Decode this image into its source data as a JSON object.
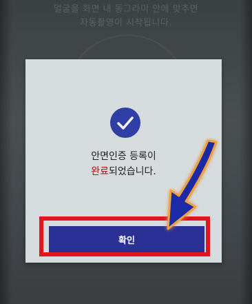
{
  "background": {
    "hint_line1": "얼굴을 화면 내 동그라미 안에 맞추면",
    "hint_line2": "자동촬영이 시작됩니다."
  },
  "dialog": {
    "icon": "check-circle-icon",
    "message_line1": "안면인증 등록이",
    "message_line2_highlight": "완료",
    "message_line2_rest": "되었습니다.",
    "confirm_label": "확인"
  },
  "colors": {
    "dialog_bg": "#d6dcde",
    "accent": "#2f3fa6",
    "button_bg": "#2b3097",
    "highlight_text": "#b3121a",
    "annotation_red": "#e3141c",
    "annotation_arrow": "#1d2aa8"
  }
}
